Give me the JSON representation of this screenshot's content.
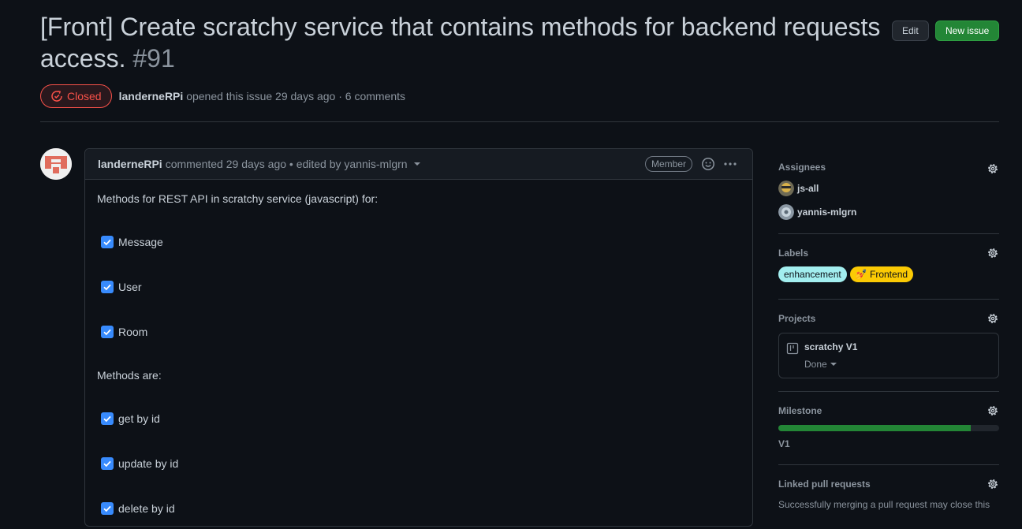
{
  "issue": {
    "title": "[Front] Create scratchy service that contains methods for backend requests access.",
    "number": "#91",
    "state": "Closed",
    "author": "landerneRPi",
    "opened_text": "opened this issue 29 days ago · 6 comments"
  },
  "header_buttons": {
    "edit": "Edit",
    "new_issue": "New issue"
  },
  "comment": {
    "author": "landerneRPi",
    "meta": "commented 29 days ago • edited by yannis-mlgrn",
    "role_badge": "Member",
    "intro": "Methods for REST API in scratchy service (javascript) for:",
    "resources": [
      "Message",
      "User",
      "Room"
    ],
    "methods_heading": "Methods are:",
    "methods": [
      "get by id",
      "update by id",
      "delete by id"
    ]
  },
  "sidebar": {
    "assignees_title": "Assignees",
    "assignees": [
      "js-all",
      "yannis-mlgrn"
    ],
    "labels_title": "Labels",
    "labels": [
      {
        "name": "enhancement",
        "color": "#a2eeef"
      },
      {
        "name": "💅 Frontend",
        "color": "#fbca04"
      }
    ],
    "projects_title": "Projects",
    "project": {
      "name": "scratchy V1",
      "status": "Done"
    },
    "milestone_title": "Milestone",
    "milestone": {
      "name": "V1",
      "progress": 0.87
    },
    "linked_title": "Linked pull requests",
    "linked_text": "Successfully merging a pull request may close this"
  }
}
